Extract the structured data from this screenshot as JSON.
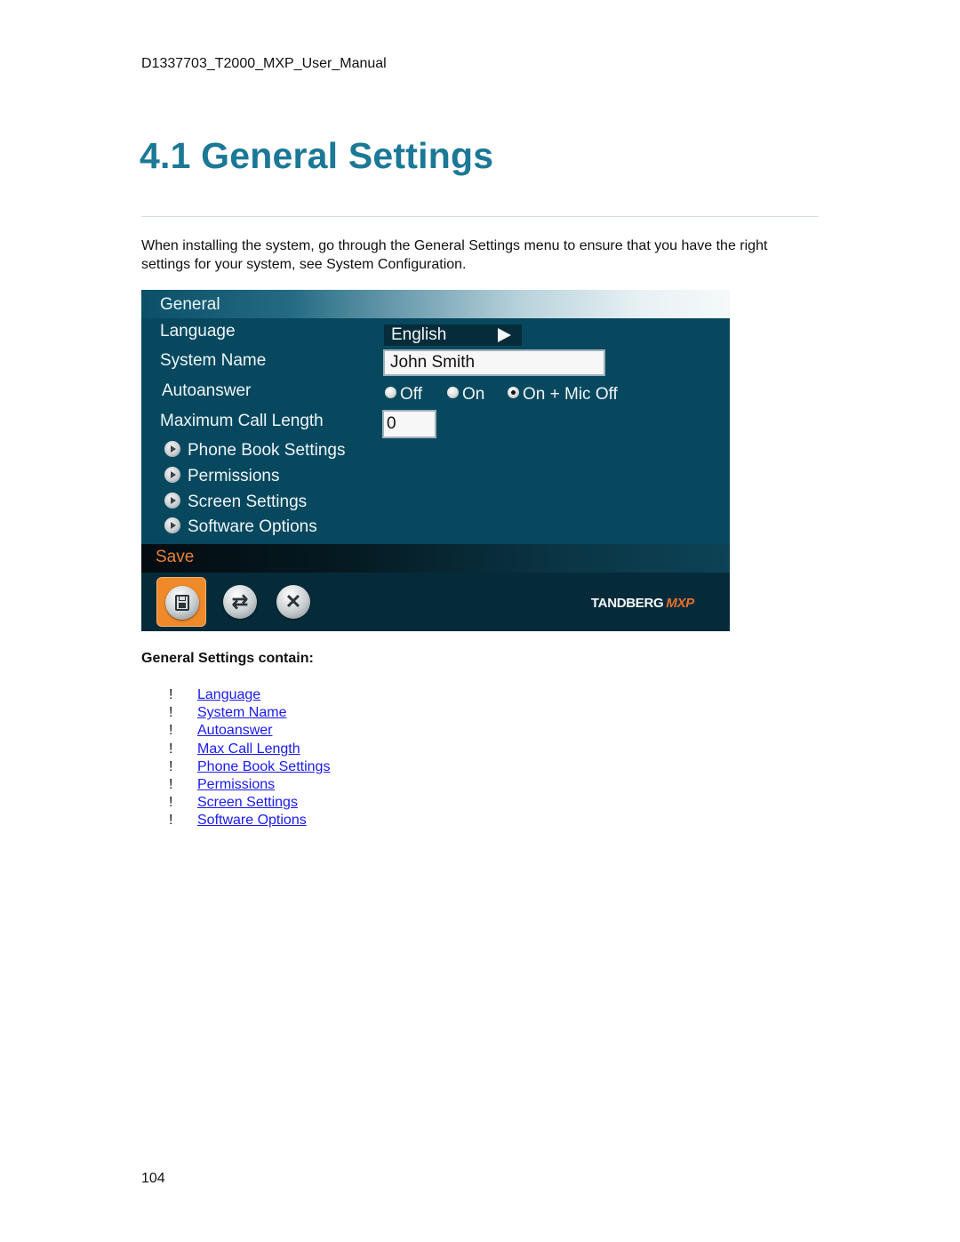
{
  "document": {
    "header": "D1337703_T2000_MXP_User_Manual",
    "section_title": "4.1 General Settings",
    "intro": "When installing the system, go through the General Settings menu to ensure that you have the right settings for your system, see System Configuration.",
    "page_number": "104"
  },
  "ui_panel": {
    "header": "General",
    "fields": {
      "language": {
        "label": "Language",
        "value": "English",
        "icon": "arrow-right-icon"
      },
      "system_name": {
        "label": "System Name",
        "value": "John Smith"
      },
      "autoanswer": {
        "label": "Autoanswer",
        "options": [
          {
            "label": "Off",
            "checked": false
          },
          {
            "label": "On",
            "checked": false
          },
          {
            "label": "On + Mic Off",
            "checked": true
          }
        ]
      },
      "max_call_length": {
        "label": "Maximum Call Length",
        "value": "0"
      }
    },
    "submenus": [
      {
        "label": "Phone Book Settings",
        "icon": "play-bullet-icon"
      },
      {
        "label": "Permissions",
        "icon": "play-bullet-icon"
      },
      {
        "label": "Screen Settings",
        "icon": "play-bullet-icon"
      },
      {
        "label": "Software Options",
        "icon": "play-bullet-icon"
      }
    ],
    "action_bar_label": "Save",
    "buttons": [
      {
        "name": "save",
        "icon": "floppy-disk-icon",
        "active": true
      },
      {
        "name": "reset",
        "icon": "refresh-icon",
        "active": false
      },
      {
        "name": "cancel",
        "icon": "close-icon",
        "active": false
      }
    ],
    "brand": {
      "name": "TANDBERG",
      "product": "MXP"
    },
    "colors": {
      "panel_bg": "#07485f",
      "accent_orange": "#ef8a2a",
      "title_teal": "#1b7896",
      "link_blue": "#1a1aee"
    }
  },
  "contents": {
    "heading": "General Settings contain:",
    "bullet": "!",
    "links": [
      "Language",
      "System Name",
      "Autoanswer",
      "Max Call Length",
      "Phone Book Settings",
      "Permissions",
      "Screen Settings",
      "Software Options"
    ]
  }
}
